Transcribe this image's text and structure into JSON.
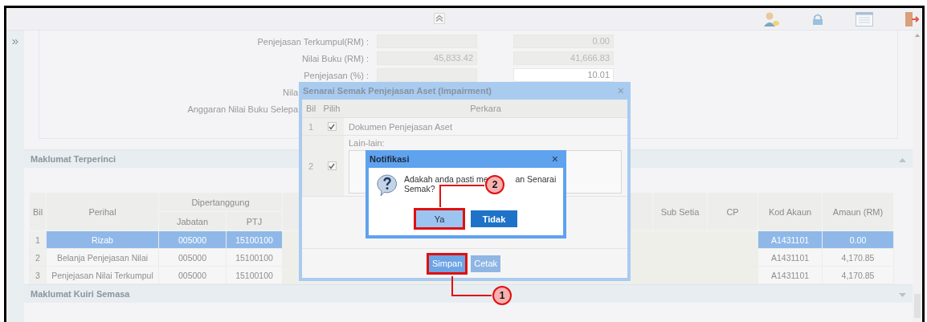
{
  "sidebar": {
    "toggle": "»"
  },
  "summary_form": {
    "rows": [
      {
        "label": "Penjejasan Terkumpul(RM) :",
        "fields": [
          {
            "editable": false
          },
          {
            "value": "0.00",
            "editable": false
          }
        ]
      },
      {
        "label": "Nilai Buku (RM) :",
        "fields": [
          {
            "value": "45,833.42",
            "editable": false
          },
          {
            "value": "41,666.83",
            "editable": false
          }
        ]
      },
      {
        "label": "Penjejasan (%) :",
        "fields": [
          {
            "editable": false
          },
          {
            "value": "10.01",
            "editable": true
          }
        ]
      },
      {
        "label": "Nila"
      },
      {
        "label": "Anggaran Nilai Buku Selepa"
      }
    ]
  },
  "sections": [
    {
      "title": "Maklumat Terperinci",
      "expanded": true
    },
    {
      "title": "Maklumat Kuiri Semasa",
      "expanded": false
    }
  ],
  "detail_table": {
    "headers": {
      "bil": "Bil",
      "perihal": "Perihal",
      "group": "Dipertanggung",
      "jabatan": "Jabatan",
      "ptj": "PTJ",
      "sub_setia": "Sub Setia",
      "cp": "CP",
      "kod_akaun": "Kod Akaun",
      "amaun": "Amaun (RM)"
    },
    "rows": [
      {
        "bil": "1",
        "perihal": "Rizab",
        "jabatan": "005000",
        "ptj": "15100100",
        "kod_akaun": "A1431101",
        "amaun": "0.00",
        "selected": true
      },
      {
        "bil": "2",
        "perihal": "Belanja Penjejasan Nilai",
        "jabatan": "005000",
        "ptj": "15100100",
        "kod_akaun": "A1431101",
        "amaun": "4,170.85",
        "selected": false
      },
      {
        "bil": "3",
        "perihal": "Penjejasan Nilai Terkumpul",
        "jabatan": "005000",
        "ptj": "15100100",
        "kod_akaun": "A1431101",
        "amaun": "4,170.85",
        "selected": false
      }
    ]
  },
  "checklist_dialog": {
    "title": "Senarai Semak Penjejasan Aset (Impairment)",
    "close": "×",
    "columns": [
      "Bil",
      "Pilih",
      "Perkara"
    ],
    "rows": [
      {
        "kind": "text",
        "bil": "1",
        "checked": true,
        "perkara": "Dokumen Penjejasan Aset"
      },
      {
        "kind": "textarea",
        "bil": "2",
        "checked": true,
        "perkara": "Lain-lain:"
      }
    ],
    "buttons": [
      {
        "label": "Simpan",
        "disabled": false,
        "highlighted": true
      },
      {
        "label": "Cetak",
        "disabled": true,
        "highlighted": false
      }
    ]
  },
  "notification": {
    "title": "Notifikasi",
    "close": "×",
    "message_parts": [
      "Adakah anda pasti me",
      "an Senarai",
      "Semak?"
    ],
    "buttons": [
      {
        "label": "Ya",
        "kind": "secondary",
        "highlighted": true
      },
      {
        "label": "Tidak",
        "kind": "primary",
        "highlighted": false
      }
    ]
  },
  "callouts": [
    {
      "number": "1"
    },
    {
      "number": "2"
    }
  ]
}
